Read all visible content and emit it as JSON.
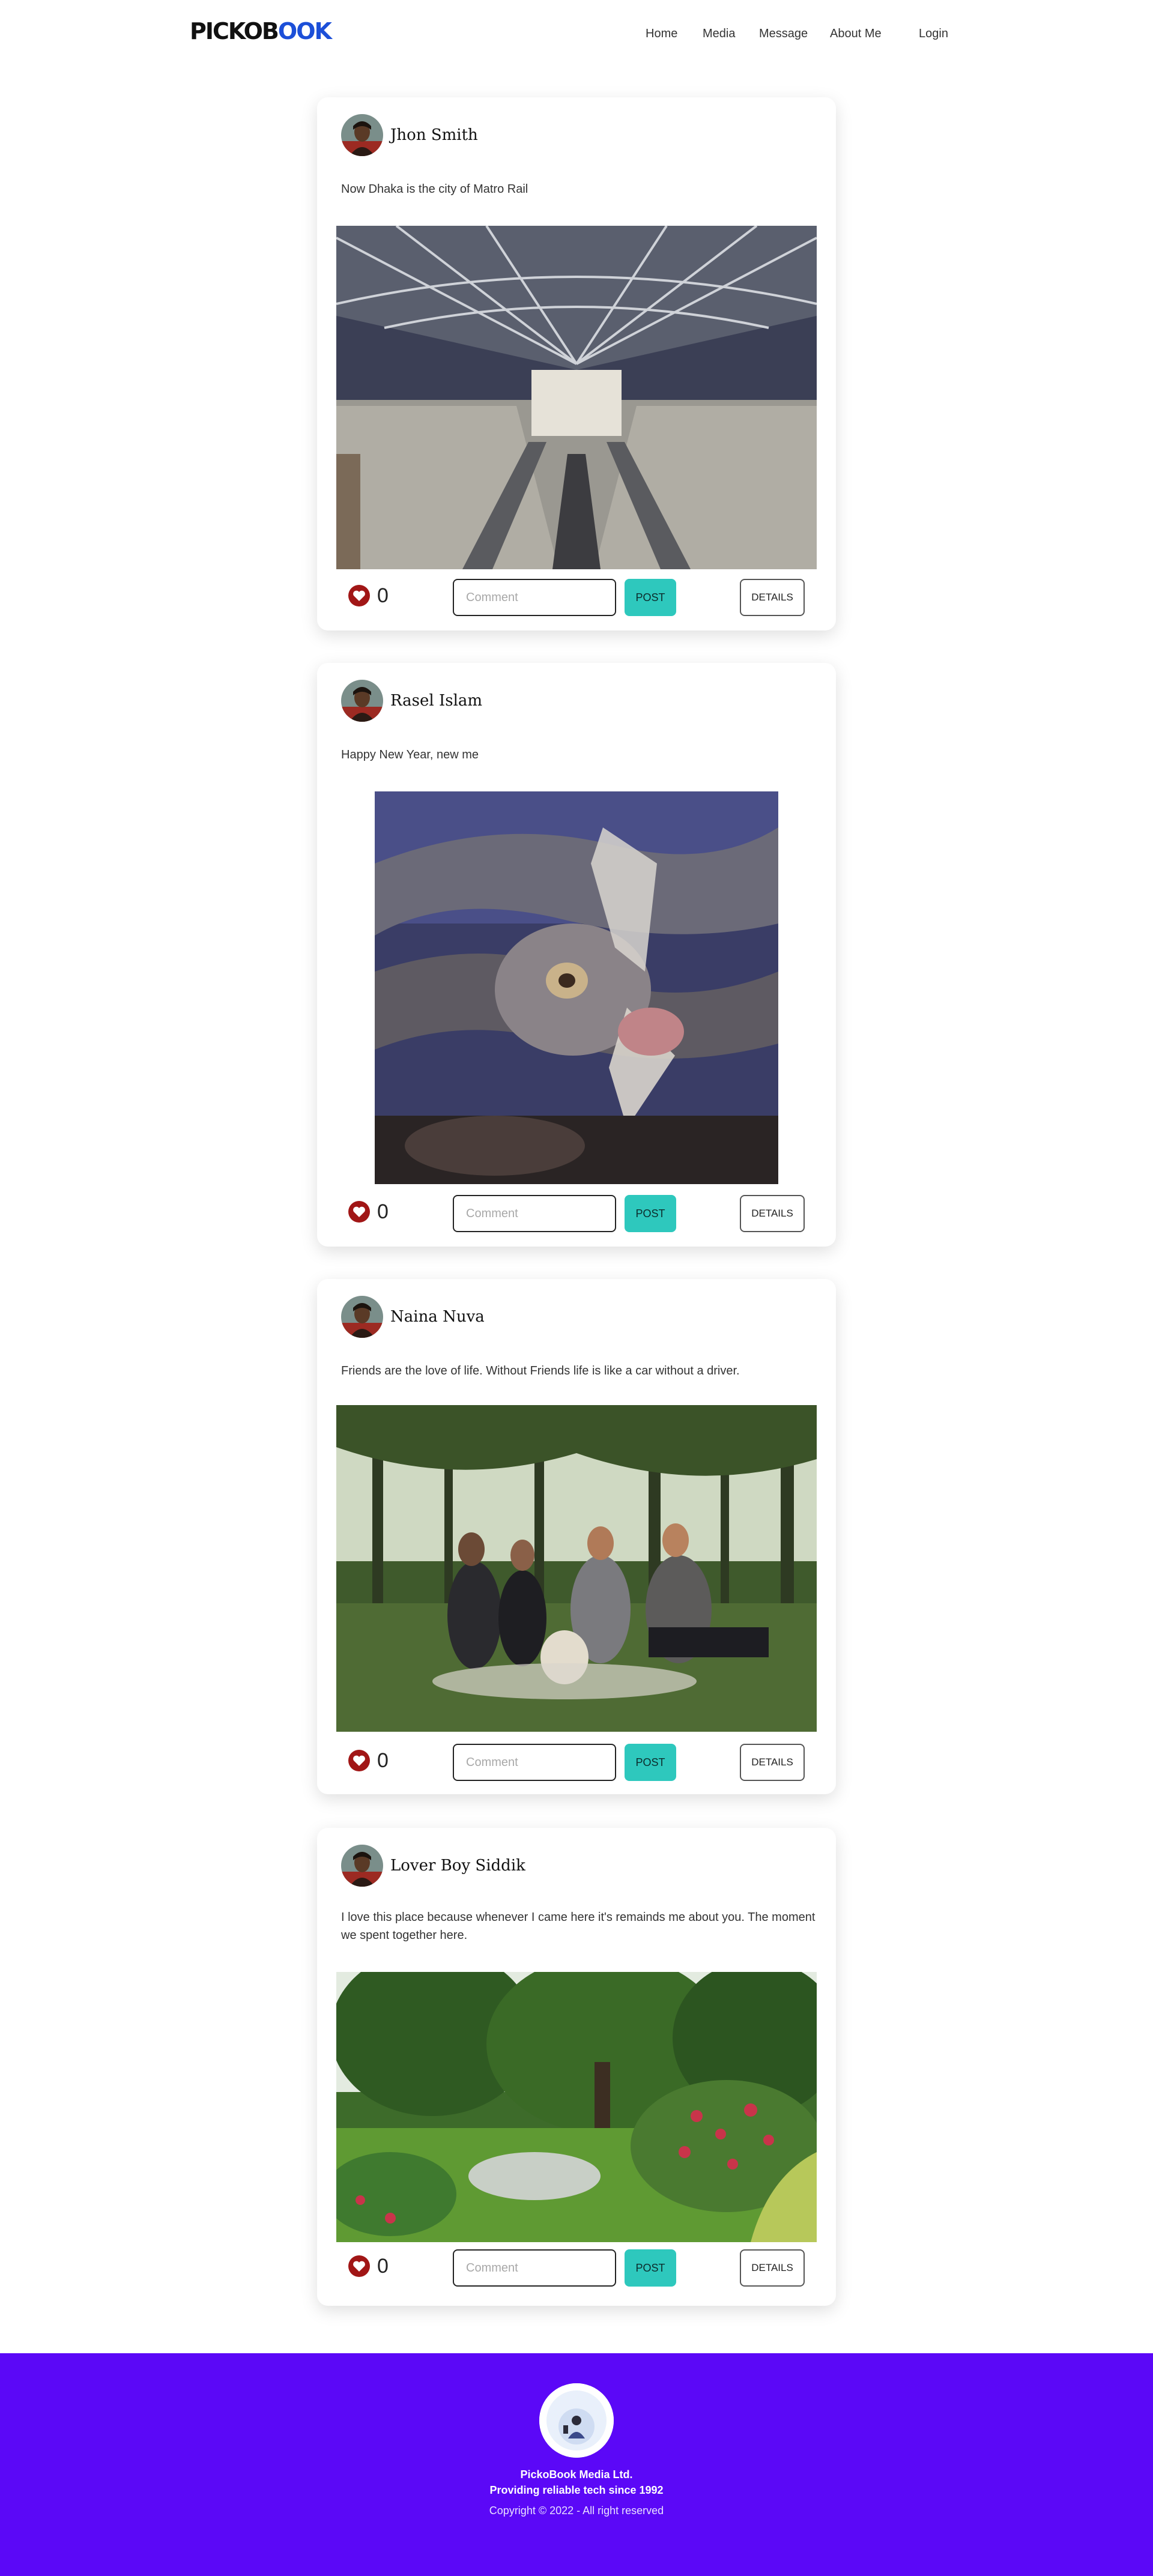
{
  "brand": {
    "logo_part1": "PICKOB",
    "logo_part2": "OOK",
    "dark_color": "#111111",
    "accent_color": "#1c4fd8"
  },
  "nav": [
    {
      "label": "Home"
    },
    {
      "label": "Media"
    },
    {
      "label": "Message"
    },
    {
      "label": "About Me"
    },
    {
      "label": "Login"
    }
  ],
  "posts": [
    {
      "author": "Jhon Smith",
      "text": "Now Dhaka is the city of Matro Rail",
      "image": "metro-station-escalator-photo",
      "likes": "0",
      "comment_placeholder": "Comment",
      "post_label": "POST",
      "details_label": "DETAILS"
    },
    {
      "author": "Rasel Islam",
      "text": "Happy New Year, new me",
      "image": "snake-shedding-skin-photo",
      "likes": "0",
      "comment_placeholder": "Comment",
      "post_label": "POST",
      "details_label": "DETAILS"
    },
    {
      "author": "Naina Nuva",
      "text": "Friends are the love of life. Without Friends life is like a car without a driver.",
      "image": "friends-picnic-photo",
      "likes": "0",
      "comment_placeholder": "Comment",
      "post_label": "POST",
      "details_label": "DETAILS"
    },
    {
      "author": "Lover Boy Siddik",
      "text": "I love this place because whenever I came here it's remainds me about you. The moment we spent together here.",
      "image": "garden-pond-photo",
      "likes": "0",
      "comment_placeholder": "Comment",
      "post_label": "POST",
      "details_label": "DETAILS"
    }
  ],
  "footer": {
    "company": "PickoBook Media Ltd.",
    "tagline": "Providing reliable tech since 1992",
    "copyright": "Copyright © 2022 - All right reserved",
    "background": "#5b08f7"
  },
  "colors": {
    "post_button": "#2ec8bd",
    "like_heart": "#a11616"
  }
}
